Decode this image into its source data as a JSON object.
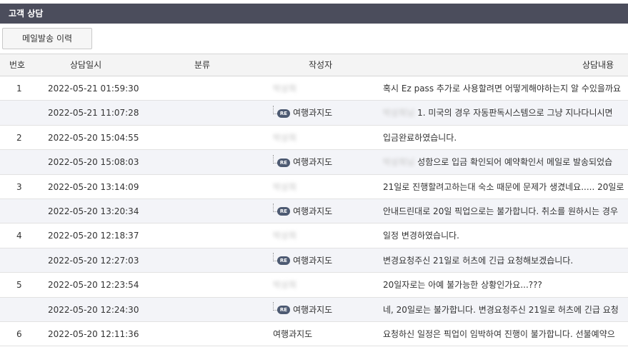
{
  "page": {
    "title": "고객 상담"
  },
  "toolbar": {
    "mail_history_label": "메일발송 이력"
  },
  "table": {
    "headers": {
      "no": "번호",
      "date": "상담일시",
      "category": "분류",
      "author": "작성자",
      "content": "상담내용"
    },
    "rows": [
      {
        "no": "1",
        "date": "2022-05-21 01:59:30",
        "category": "",
        "author_blurred": "박상희",
        "reply": false,
        "content_blurred": "",
        "content": "혹시 Ez pass 추가로 사용할려면 어떻게해야하는지 알 수있을까요"
      },
      {
        "no": "",
        "date": "2022-05-21 11:07:28",
        "category": "",
        "reply": true,
        "author": "여행과지도",
        "reply_badge": "RE",
        "content_blurred": "박상희님",
        "content": "1. 미국의 경우 자동판독시스템으로 그냥 지나다니시면"
      },
      {
        "no": "2",
        "date": "2022-05-20 15:04:55",
        "category": "",
        "author_blurred": "박상희",
        "reply": false,
        "content_blurred": "",
        "content": "입금완료하였습니다."
      },
      {
        "no": "",
        "date": "2022-05-20 15:08:03",
        "category": "",
        "reply": true,
        "author": "여행과지도",
        "reply_badge": "RE",
        "content_blurred": "박상희님",
        "content": "성함으로 입금 확인되어 예약확인서 메일로 발송되었습"
      },
      {
        "no": "3",
        "date": "2022-05-20 13:14:09",
        "category": "",
        "author_blurred": "박상희",
        "reply": false,
        "content_blurred": "",
        "content": "21일로 진행할려고하는대 숙소 때문에 문제가 생겼네요..... 20일로"
      },
      {
        "no": "",
        "date": "2022-05-20 13:20:34",
        "category": "",
        "reply": true,
        "author": "여행과지도",
        "reply_badge": "RE",
        "content_blurred": "",
        "content": "안내드린대로 20일 픽업으로는 불가합니다. 취소를 원하시는 경우"
      },
      {
        "no": "4",
        "date": "2022-05-20 12:18:37",
        "category": "",
        "author_blurred": "박상희",
        "reply": false,
        "content_blurred": "",
        "content": "일정 변경하였습니다."
      },
      {
        "no": "",
        "date": "2022-05-20 12:27:03",
        "category": "",
        "reply": true,
        "author": "여행과지도",
        "reply_badge": "RE",
        "content_blurred": "",
        "content": "변경요청주신 21일로 허츠에 긴급 요청해보겠습니다."
      },
      {
        "no": "5",
        "date": "2022-05-20 12:23:54",
        "category": "",
        "author_blurred": "박상희",
        "reply": false,
        "content_blurred": "",
        "content": "20일자로는 아예 불가능한 상황인가요...???"
      },
      {
        "no": "",
        "date": "2022-05-20 12:24:30",
        "category": "",
        "reply": true,
        "author": "여행과지도",
        "reply_badge": "RE",
        "content_blurred": "",
        "content": "네, 20일로는 불가합니다. 변경요청주신 21일로 허츠에 긴급 요청"
      },
      {
        "no": "6",
        "date": "2022-05-20 12:11:36",
        "category": "",
        "author": "여행과지도",
        "reply": false,
        "content_blurred": "",
        "content": "요청하신 일정은 픽업이 임박하여 진행이 불가합니다. 선불예약으"
      }
    ]
  }
}
